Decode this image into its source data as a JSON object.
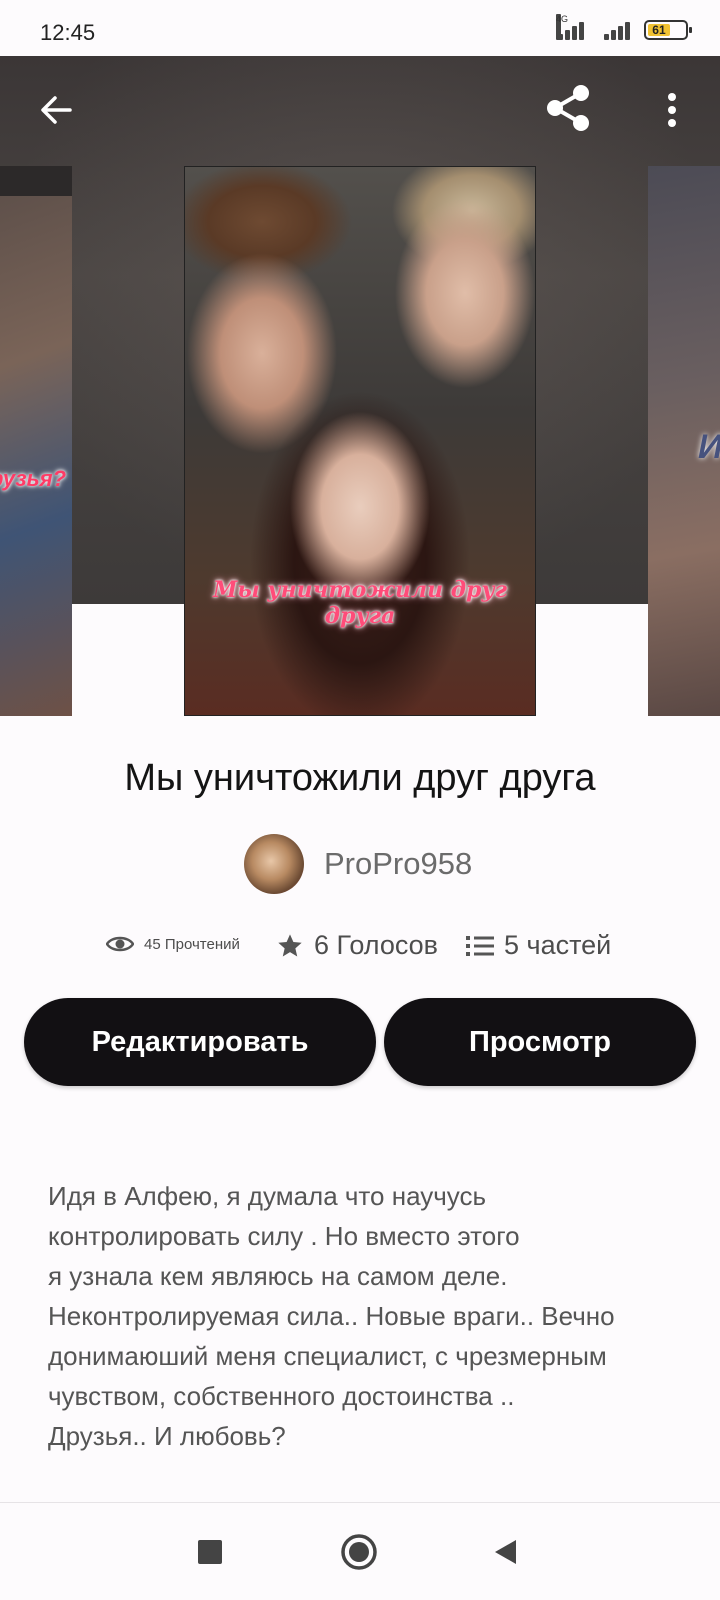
{
  "status_bar": {
    "time": "12:45",
    "network_type": "4G",
    "battery_level": "61"
  },
  "header": {
    "back_icon": "arrow-left-icon",
    "share_icon": "share-icon",
    "more_icon": "more-vertical-icon"
  },
  "covers": {
    "left_text": "рузья?",
    "main_text": "Мы уничтожили друг друга",
    "right_text": "И"
  },
  "book": {
    "title": "Мы уничтожили друг друга",
    "author": "ProPro958",
    "stats": {
      "reads": "45 Прочтений",
      "votes": "6 Голосов",
      "parts": "5 частей"
    }
  },
  "buttons": {
    "edit": "Редактировать",
    "view": "Просмотр"
  },
  "description": "Идя в Алфею, я думала что научусь\nконтролировать силу . Но вместо этого\nя узнала кем являюсь на самом деле.\nНеконтролируемая сила.. Новые враги.. Вечно\nдонимаюший меня специалист, с чрезмерным\nчувством, собственного достоинства ..\nДрузья.. И любовь?",
  "colors": {
    "button_bg": "#121013",
    "cover_title": "#ff4c79",
    "battery_fill": "#f1c232"
  }
}
